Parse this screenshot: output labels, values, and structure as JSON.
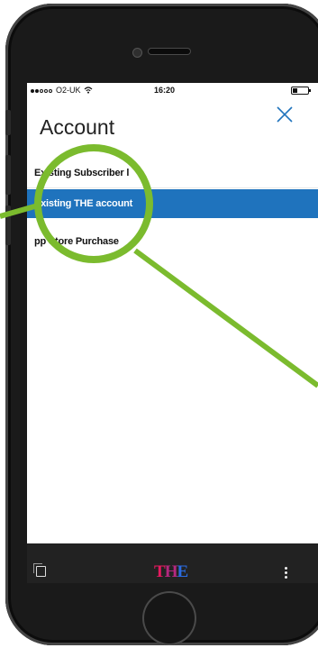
{
  "status_bar": {
    "carrier": "O2-UK",
    "time": "16:20"
  },
  "header": {
    "title": "Account",
    "close_icon": "close-icon"
  },
  "menu": {
    "items": [
      {
        "label": "Existing Subscriber l",
        "selected": false
      },
      {
        "label": "Existing THE account",
        "selected": true
      },
      {
        "label": "pp Store Purchase",
        "selected": false
      }
    ]
  },
  "bottom_bar": {
    "logo": "THE",
    "tabs_icon": "tabs-icon",
    "more_icon": "more-icon"
  },
  "colors": {
    "accent": "#1f73bd",
    "highlight_ring": "#7bbb2e",
    "logo_t": "#e5195f",
    "logo_e": "#2a6be0"
  }
}
